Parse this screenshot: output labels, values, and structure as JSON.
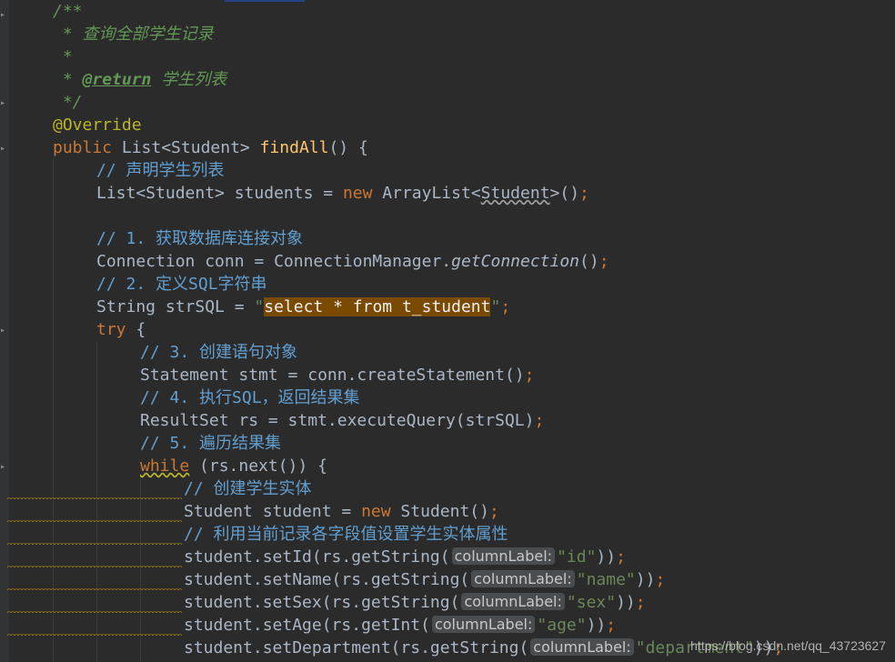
{
  "javadoc": {
    "open": "/**",
    "desc": " * 查询全部学生记录",
    "blank": " *",
    "return_prefix": " * ",
    "return_tag": "@return",
    "return_text": " 学生列表",
    "close": " */"
  },
  "method": {
    "annotation": "@Override",
    "modifier": "public",
    "return_type": " List<Student> ",
    "name": "findAll",
    "params": "() {"
  },
  "code": {
    "c_declare": "// 声明学生列表",
    "list_decl_a": "List<Student> students = ",
    "new_kw": "new",
    "list_decl_b": " ArrayList<",
    "list_decl_generic": "Student",
    "list_decl_c": ">()",
    "semi": ";",
    "c1": "// 1. 获取数据库连接对象",
    "conn_a": "Connection conn = ConnectionManager.",
    "conn_method": "getConnection",
    "conn_b": "()",
    "c2": "// 2. 定义SQL字符串",
    "sql_a": "String strSQL = ",
    "quote": "\"",
    "sql_text": "select * from t_student",
    "try_kw": "try",
    "try_brace": " {",
    "c3": "// 3. 创建语句对象",
    "stmt": "Statement stmt = conn.createStatement()",
    "c4": "// 4. 执行SQL，返回结果集",
    "rs": "ResultSet rs = stmt.executeQuery(strSQL)",
    "c5": "// 5. 遍历结果集",
    "while_kw": "while",
    "while_rest": " (rs.next()) {",
    "c_create": "// 创建学生实体",
    "student_a": "Student student = ",
    "student_b": " Student()",
    "c_set": "// 利用当前记录各字段值设置学生实体属性",
    "hint_label": "columnLabel:",
    "setId_a": "student.setId(rs.getString(",
    "setId_s": "\"id\"",
    "setName_a": "student.setName(rs.getString(",
    "setName_s": "\"name\"",
    "setSex_a": "student.setSex(rs.getString(",
    "setSex_s": "\"sex\"",
    "setAge_a": "student.setAge(rs.getInt(",
    "setAge_s": "\"age\"",
    "setDept_a": "student.setDepartment(rs.getString(",
    "setDept_s": "\"department\"",
    "close_paren": "))"
  },
  "watermark": "https://blog.csdn.net/qq_43723627"
}
